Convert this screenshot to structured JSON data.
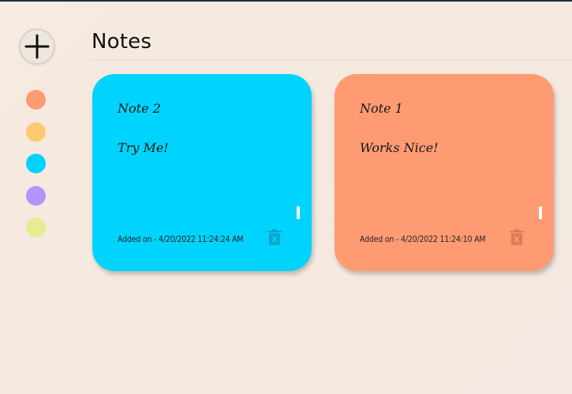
{
  "app": {
    "heading": "Notes"
  },
  "sidebar": {
    "add_button_icon": "plus-icon",
    "colors": [
      {
        "name": "orange",
        "hex": "#ff9b73"
      },
      {
        "name": "yellow",
        "hex": "#ffc971"
      },
      {
        "name": "cyan",
        "hex": "#00d4fe"
      },
      {
        "name": "purple",
        "hex": "#b593fd"
      },
      {
        "name": "lime",
        "hex": "#e4ee90"
      }
    ]
  },
  "notes": [
    {
      "title": "Note 2",
      "body": "Try Me!",
      "added": "Added on - 4/20/2022 11:24:24 AM",
      "color": "#00d4fe",
      "delete_icon": "trash-icon"
    },
    {
      "title": "Note 1",
      "body": "Works Nice!",
      "added": "Added on - 4/20/2022 11:24:10 AM",
      "color": "#ff9b73",
      "delete_icon": "trash-icon"
    }
  ]
}
